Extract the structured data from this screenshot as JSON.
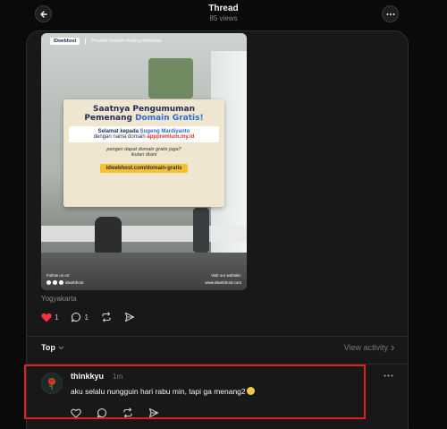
{
  "header": {
    "title": "Thread",
    "views": "85 views",
    "back_icon": "arrow-left-icon",
    "more_icon": "ellipsis-icon"
  },
  "post": {
    "image": {
      "brand": "IDwebhost",
      "tagline": "Provider Domain Hosting Indonesia",
      "headline_line1": "Saatnya Pengumuman",
      "headline_line2_prefix": "Pemenang ",
      "headline_line2_accent": "Domain Gratis!",
      "winner_prefix": "Selamat kepada ",
      "winner_name": "Sugeng Mardiyanto",
      "winner_domain_prefix": "dengan nama domain ",
      "winner_domain": "apppremium.my.id",
      "question1": "pengen dapat domain gratis juga?",
      "question2": "ikutan disini",
      "cta_url": "idwebhost.com/domain-gratis",
      "footer_follow": "Follow us on:",
      "footer_handle": "idwebhost",
      "footer_site_label": "Visit our website:",
      "footer_site": "www.idwebhost.com"
    },
    "location": "Yogyakarta",
    "likes": "1",
    "replies": "1"
  },
  "sort": {
    "label": "Top",
    "view_activity": "View activity"
  },
  "comment": {
    "username": "thinkkyu",
    "time": "1m",
    "text": "aku selalu nungguin hari rabu min, tapi ga menang2"
  },
  "colors": {
    "background": "#0a0a0a",
    "panel": "#181818",
    "like_red": "#ff3040",
    "highlight_red": "#e0201f"
  }
}
